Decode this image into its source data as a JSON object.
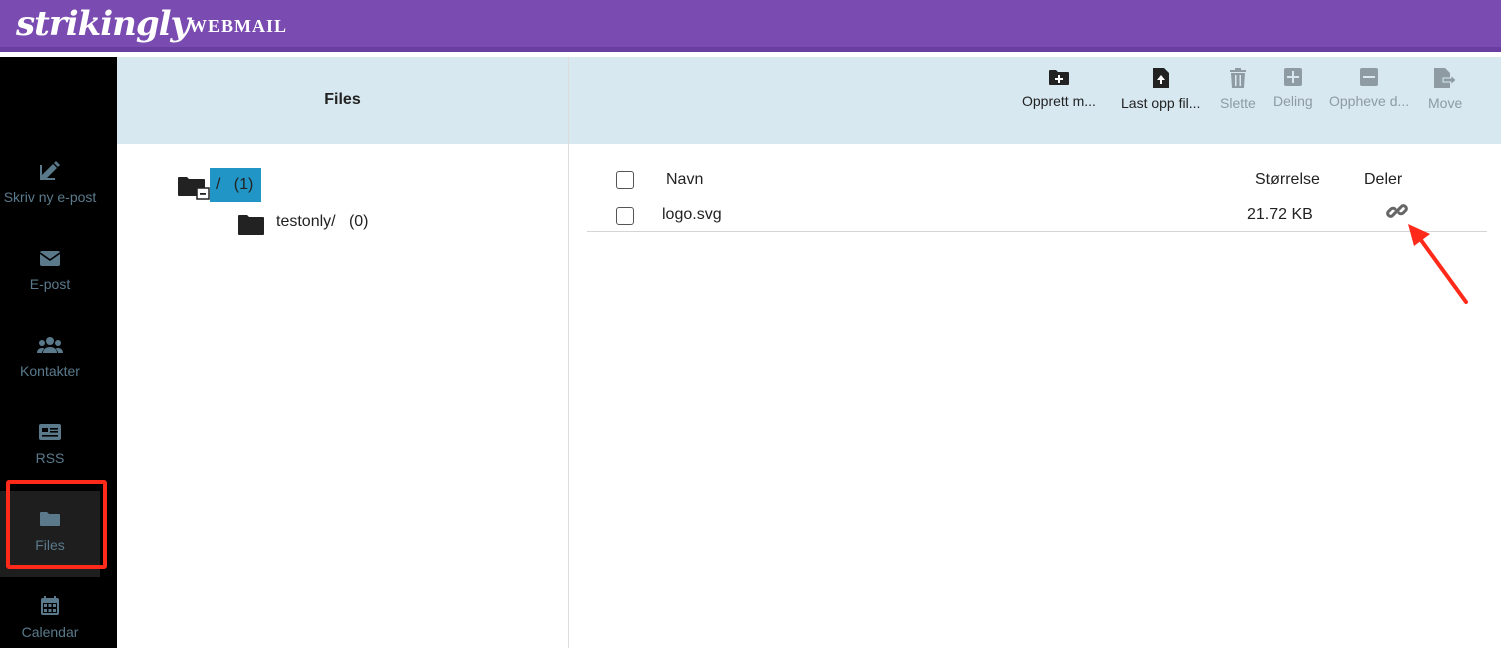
{
  "header": {
    "brand": "strikingly",
    "product": "WEBMAIL",
    "brand_color": "#7a4bb0"
  },
  "sidebar": {
    "items": [
      {
        "label": "Skriv ny e-post",
        "icon": "compose-icon"
      },
      {
        "label": "E-post",
        "icon": "envelope-icon"
      },
      {
        "label": "Kontakter",
        "icon": "contacts-icon"
      },
      {
        "label": "RSS",
        "icon": "rss-icon"
      },
      {
        "label": "Files",
        "icon": "folder-icon",
        "active": true
      },
      {
        "label": "Calendar",
        "icon": "calendar-icon"
      }
    ]
  },
  "files_panel": {
    "title": "Files"
  },
  "toolbar": {
    "create_folder": "Opprett m...",
    "upload_file": "Last opp fil...",
    "delete": "Slette",
    "share": "Deling",
    "unshare": "Oppheve d...",
    "move": "Move"
  },
  "tree": {
    "root": {
      "name": "/",
      "count": "(1)"
    },
    "children": [
      {
        "name": "testonly/",
        "count": "(0)"
      }
    ]
  },
  "file_list": {
    "columns": {
      "name": "Navn",
      "size": "Størrelse",
      "share": "Deler"
    },
    "rows": [
      {
        "name": "logo.svg",
        "size": "21.72 KB",
        "share_icon": "link-icon"
      }
    ]
  },
  "annotation_color": "#ff2a1a"
}
